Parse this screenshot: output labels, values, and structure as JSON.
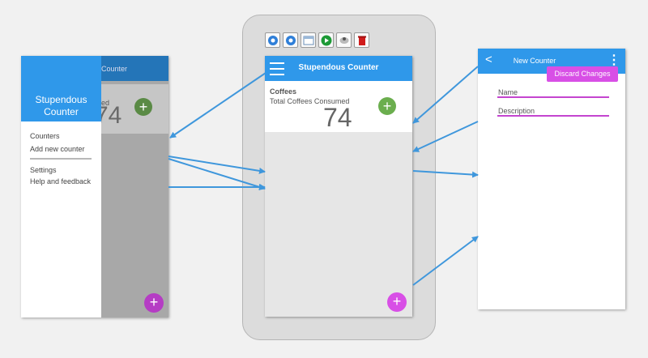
{
  "toolbar": {
    "icons": [
      "gear-blue-icon",
      "gear-blue-icon",
      "window-icon",
      "play-icon",
      "sheep-icon",
      "trash-icon"
    ]
  },
  "main_screen": {
    "title": "Stupendous Counter",
    "card_title": "Coffees",
    "card_subtitle": "Total Coffees Consumed",
    "count": "74",
    "add_symbol": "+",
    "fab_symbol": "+"
  },
  "left_screen": {
    "drawer_title_line1": "Stupendous",
    "drawer_title_line2": "Counter",
    "items": [
      "Counters",
      "Add new counter",
      "Settings",
      "Help and feedback"
    ],
    "peek_title": "Counter",
    "peek_subtitle": "ed",
    "peek_count": "74",
    "add_symbol": "+",
    "fab_symbol": "+"
  },
  "right_screen": {
    "back": "<",
    "title": "New Counter",
    "menu": "⋮",
    "discard": "Discard Changes",
    "name_label": "Name",
    "description_label": "Description"
  },
  "colors": {
    "appbar": "#2f98ea",
    "arrow": "#3f97dc",
    "green_fab": "#6bae4e",
    "pink_fab": "#d84fe6",
    "field_underline": "#c445cf"
  }
}
